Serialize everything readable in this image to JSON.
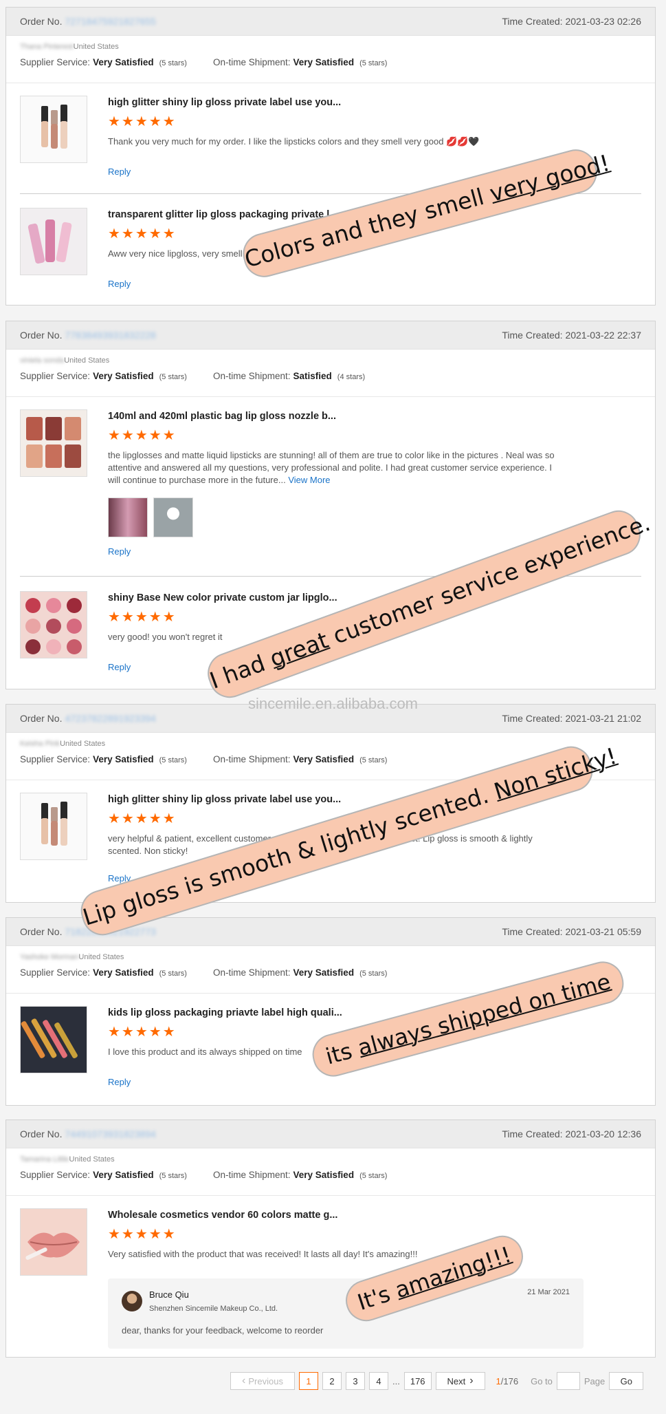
{
  "labels": {
    "order_no": "Order No.",
    "time_created": "Time Created:",
    "supplier_service": "Supplier Service:",
    "ontime_shipment": "On-time Shipment:",
    "reply": "Reply",
    "view_more": "View More",
    "star_glyphs": "★★★★★"
  },
  "orders": [
    {
      "order_no_hidden": "72718475921827655",
      "time": "2021-03-23 02:26",
      "buyer_hidden": "Thana Pinterest",
      "country": "United States",
      "supplier_rating": "Very Satisfied",
      "supplier_stars": "(5 stars)",
      "ship_rating": "Very Satisfied",
      "ship_stars": "(5 stars)",
      "items": [
        {
          "title": "high glitter shiny lip gloss private label use you...",
          "rating": 5,
          "text": "Thank you very much for my order. I like the lipsticks colors and they smell very good 💋💋🖤"
        },
        {
          "title": "transparent glitter lip gloss packaging private l...",
          "rating": 5,
          "text": "Aww very nice lipgloss, very smell good 😍"
        }
      ]
    },
    {
      "order_no_hidden": "77838493931832228",
      "time": "2021-03-22 22:37",
      "buyer_hidden": "viniela sonda",
      "country": "United States",
      "supplier_rating": "Very Satisfied",
      "supplier_stars": "(5 stars)",
      "ship_rating": "Satisfied",
      "ship_stars": "(4 stars)",
      "items": [
        {
          "title": "140ml and 420ml plastic bag lip gloss nozzle b...",
          "rating": 5,
          "text": "the lipglosses and matte liquid lipsticks are stunning! all of them are true to color like in the pictures . Neal was so attentive and answered all my questions, very professional and polite. I had  great customer service experience. I will continue to purchase more in the future..."
        },
        {
          "title": "shiny Base New color private custom jar lipglo...",
          "rating": 5,
          "text": "very good! you won't regret it"
        }
      ]
    },
    {
      "order_no_hidden": "47237822891923394",
      "time": "2021-03-21 21:02",
      "buyer_hidden": "Keisha Pink",
      "country": "United States",
      "supplier_rating": "Very Satisfied",
      "supplier_stars": "(5 stars)",
      "ship_rating": "Very Satisfied",
      "ship_stars": "(5 stars)",
      "items": [
        {
          "title": "high glitter shiny lip gloss private label use you...",
          "rating": 5,
          "text": "very helpful & patient, excellent customer service, fast delivery & great product! Lip gloss is smooth & lightly scented. Non sticky!"
        }
      ]
    },
    {
      "order_no_hidden": "71822883921922773",
      "time": "2021-03-21 05:59",
      "buyer_hidden": "Yashoke Morman",
      "country": "United States",
      "supplier_rating": "Very Satisfied",
      "supplier_stars": "(5 stars)",
      "ship_rating": "Very Satisfied",
      "ship_stars": "(5 stars)",
      "items": [
        {
          "title": "kids lip gloss packaging priavte label high quali...",
          "rating": 5,
          "text": "I love this product and its always shipped on time"
        }
      ]
    },
    {
      "order_no_hidden": "74491073931823894",
      "time": "2021-03-20 12:36",
      "buyer_hidden": "Tamarina Little",
      "country": "United States",
      "supplier_rating": "Very Satisfied",
      "supplier_stars": "(5 stars)",
      "ship_rating": "Very Satisfied",
      "ship_stars": "(5 stars)",
      "items": [
        {
          "title": "Wholesale cosmetics vendor 60 colors matte g...",
          "rating": 5,
          "text": "Very satisfied with the product that was received! It lasts all day! It's amazing!!!"
        }
      ],
      "seller_reply": {
        "name": "Bruce Qiu",
        "company": "Shenzhen Sincemile Makeup Co., Ltd.",
        "date": "21 Mar 2021",
        "text": "dear, thanks for your feedback, welcome to reorder"
      }
    }
  ],
  "callouts": {
    "c1_prefix": "Colors and they smell ",
    "c1_u": "very good!",
    "c2_prefix": "I had  ",
    "c2_u": "great",
    "c2_suffix": " customer service experience.",
    "c3_prefix": "Lip gloss is smooth & lightly scented. ",
    "c3_u": "Non sticky!",
    "c4_prefix": "its ",
    "c4_u": "always shipped on time",
    "c5_prefix": "It's ",
    "c5_u": "amazing!!!"
  },
  "watermark": "sincemile.en.alibaba.com",
  "pagination": {
    "prev": "Previous",
    "pages": [
      "1",
      "2",
      "3",
      "4"
    ],
    "ellipsis": "...",
    "last": "176",
    "next": "Next",
    "current": "1",
    "total": "/176",
    "go_to": "Go to",
    "page_label": "Page",
    "go": "Go"
  },
  "colors": {
    "star": "#ff6a00",
    "link": "#1a73c8",
    "callout_bg": "#f9c9b0",
    "active_page": "#ff6a00"
  }
}
